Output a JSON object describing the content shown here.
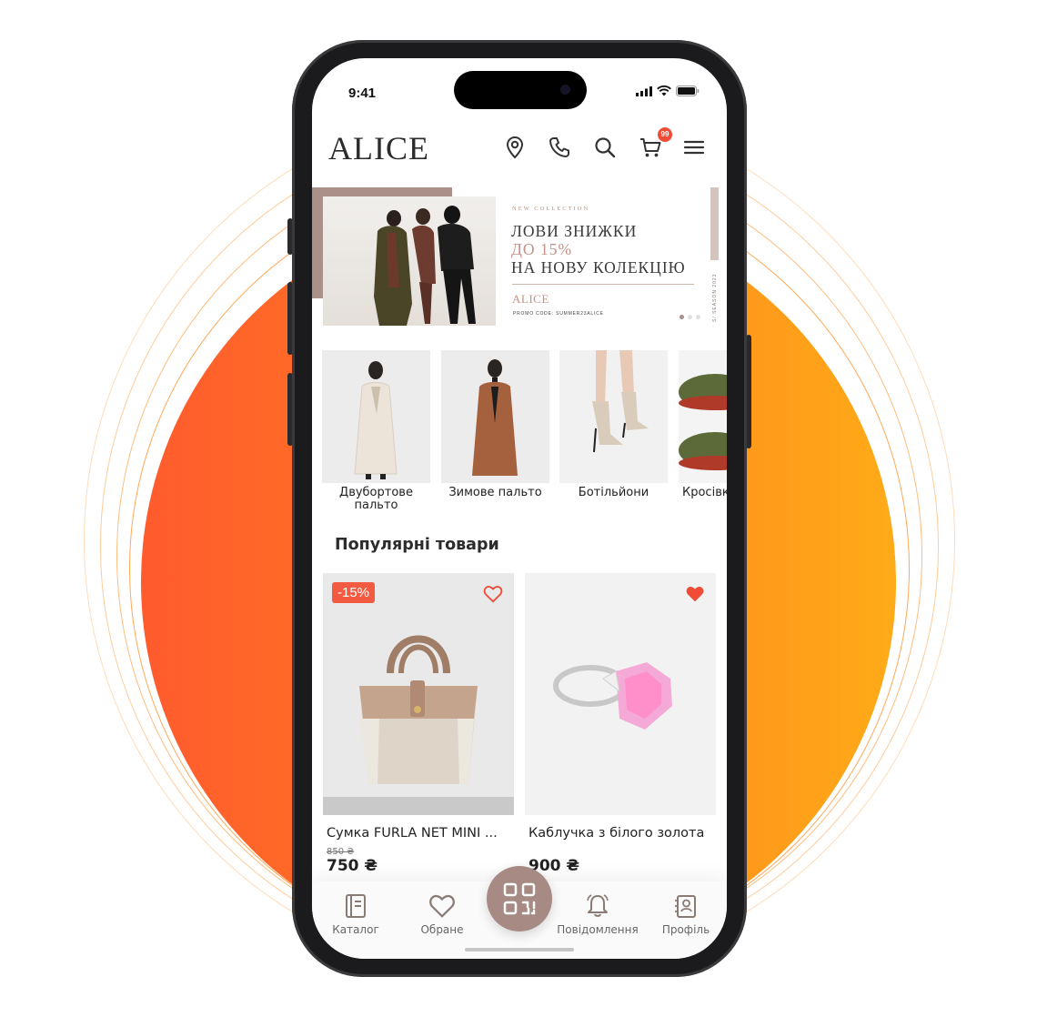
{
  "status_bar": {
    "time": "9:41"
  },
  "header": {
    "logo": "ALICE",
    "icons": [
      "location-icon",
      "phone-icon",
      "search-icon",
      "cart-icon",
      "menu-icon"
    ],
    "cart_count": "99"
  },
  "banner": {
    "eyebrow": "NEW COLLECTION",
    "line1": "ЛОВИ ЗНИЖКИ",
    "line2": "ДО 15%",
    "line3": "НА НОВУ КОЛЕКЦІЮ",
    "brand": "ALICE",
    "promo": "PROMO CODE: SUMMER23ALICE",
    "side_text": "S/ SEASON 2023",
    "slide_index": 1,
    "slide_count": 3
  },
  "categories": [
    {
      "label": "Двубортове\nпальто"
    },
    {
      "label": "Зимове пальто"
    },
    {
      "label": "Ботільйони"
    },
    {
      "label": "Кросівки"
    }
  ],
  "popular": {
    "title": "Популярні товари",
    "products": [
      {
        "name": "Сумка FURLA NET MINI ...",
        "old_price": "850 ₴",
        "price": "750 ₴",
        "badge": "-15%",
        "favorite": false
      },
      {
        "name": "Каблучка з білого золота",
        "old_price": "",
        "price": "900 ₴",
        "badge": "",
        "favorite": true
      }
    ]
  },
  "tabbar": {
    "tabs": [
      {
        "label": "Каталог",
        "icon": "catalog-icon"
      },
      {
        "label": "Обране",
        "icon": "heart-icon"
      },
      {
        "label": "Повідомлення",
        "icon": "bell-icon"
      },
      {
        "label": "Профіль",
        "icon": "profile-icon"
      }
    ],
    "center_icon": "qr-scan-icon"
  },
  "colors": {
    "accent": "#a68a83",
    "sale": "#f35a42",
    "bg_gradient_start": "#ff5b2e",
    "bg_gradient_end": "#ffab18"
  }
}
